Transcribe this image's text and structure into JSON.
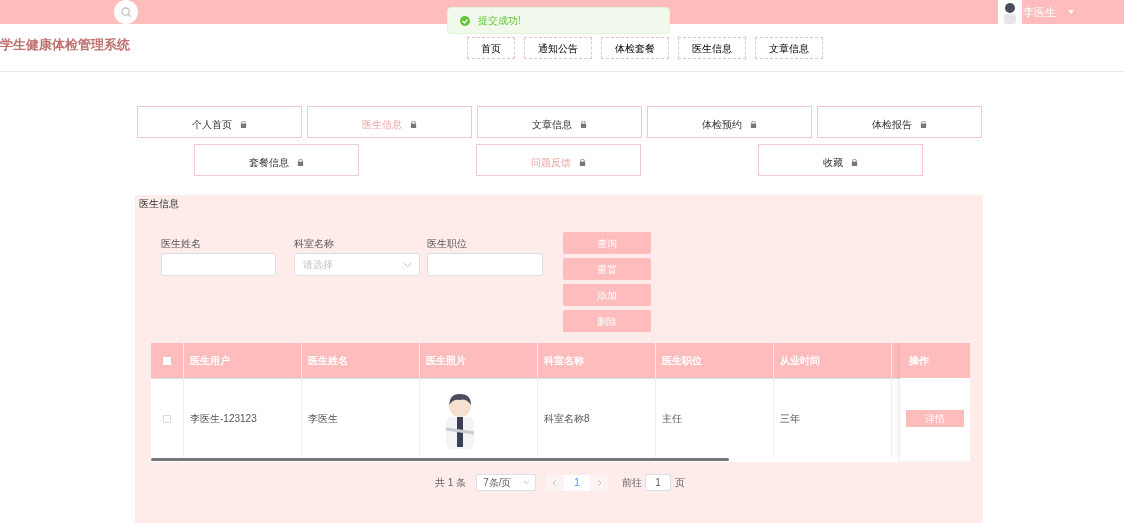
{
  "top_bar": {
    "user": {
      "name": "李医生"
    }
  },
  "toast": {
    "message": "提交成功!",
    "kind": "success"
  },
  "header": {
    "title": "学生健康体检管理系统",
    "nav": [
      {
        "label": "首页"
      },
      {
        "label": "通知公告"
      },
      {
        "label": "体检套餐"
      },
      {
        "label": "医生信息"
      },
      {
        "label": "文章信息"
      }
    ]
  },
  "menu_rows": [
    [
      {
        "label": "个人首页",
        "active": false
      },
      {
        "label": "医生信息",
        "active": true
      },
      {
        "label": "文章信息",
        "active": false
      },
      {
        "label": "体检预约",
        "active": false
      },
      {
        "label": "体检报告",
        "active": false
      }
    ],
    [
      {
        "label": "套餐信息",
        "active": false
      },
      {
        "label": "问题反馈",
        "active": true
      },
      {
        "label": "收藏",
        "active": false
      }
    ]
  ],
  "panel": {
    "title": "医生信息",
    "filters": [
      {
        "label": "医生姓名",
        "kind": "text"
      },
      {
        "label": "科室名称",
        "kind": "select",
        "placeholder": "请选择"
      },
      {
        "label": "医生职位",
        "kind": "text"
      }
    ],
    "buttons": [
      "查询",
      "重置",
      "添加",
      "删除"
    ],
    "table": {
      "select_all_checked": false,
      "columns": [
        "医生用户",
        "医生姓名",
        "医生照片",
        "科室名称",
        "医生职位",
        "从业时间"
      ],
      "action_column": "操作",
      "rows": [
        {
          "checked": false,
          "cells": [
            {
              "kind": "text",
              "text": "李医生-123123"
            },
            {
              "kind": "text",
              "text": "李医生"
            },
            {
              "kind": "picture"
            },
            {
              "kind": "text",
              "text": "科室名称8"
            },
            {
              "kind": "text",
              "text": "主任"
            },
            {
              "kind": "text",
              "text": "三年"
            }
          ],
          "action": "详情"
        }
      ]
    },
    "pagination": {
      "total": "共 1 条",
      "page_size": "7条/页",
      "pages": [
        {
          "label": "1",
          "selected": true
        }
      ],
      "goto_label": "前往",
      "goto_value": "1",
      "goto_suffix": "页"
    }
  }
}
